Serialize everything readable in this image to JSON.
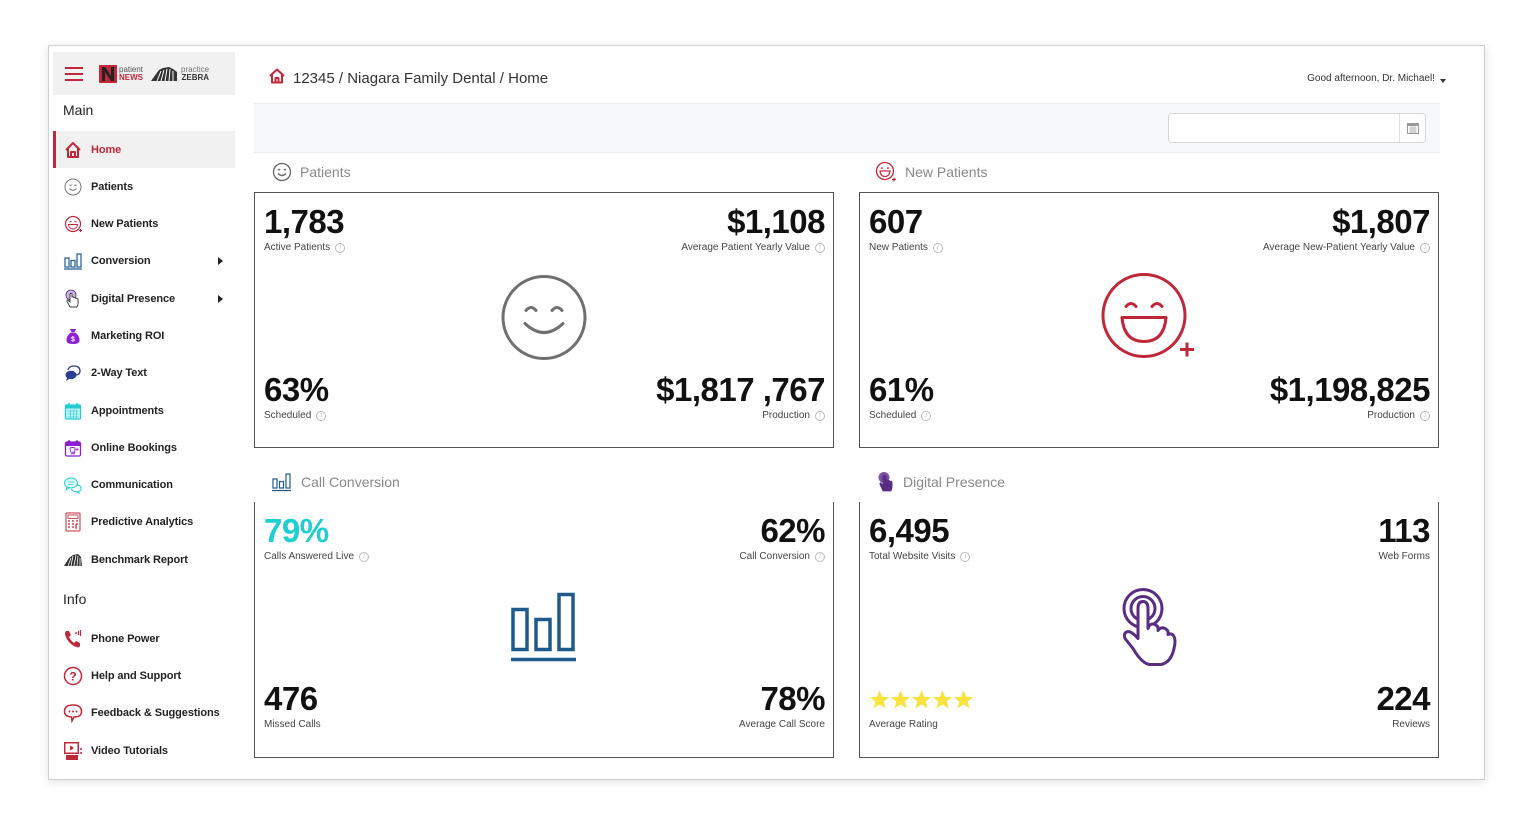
{
  "brand": {
    "patient_news_top": "patient",
    "patient_news_bottom": "NEWS",
    "practice_zebra_top": "practice",
    "practice_zebra_bottom": "ZEBRA"
  },
  "sidebar": {
    "main_heading": "Main",
    "info_heading": "Info",
    "main_items": [
      {
        "label": "Home",
        "icon": "home-icon",
        "active": true
      },
      {
        "label": "Patients",
        "icon": "smiley-icon"
      },
      {
        "label": "New Patients",
        "icon": "laughing-face-plus-icon"
      },
      {
        "label": "Conversion",
        "icon": "bar-chart-icon",
        "submenu": true
      },
      {
        "label": "Digital Presence",
        "icon": "touch-hand-icon",
        "submenu": true
      },
      {
        "label": "Marketing ROI",
        "icon": "money-bag-icon"
      },
      {
        "label": "2-Way Text",
        "icon": "chat-bubbles-icon"
      },
      {
        "label": "Appointments",
        "icon": "calendar-icon"
      },
      {
        "label": "Online Bookings",
        "icon": "calendar-tooth-icon"
      },
      {
        "label": "Communication",
        "icon": "speech-bubbles-icon"
      },
      {
        "label": "Predictive Analytics",
        "icon": "calculator-icon"
      },
      {
        "label": "Benchmark Report",
        "icon": "zebra-icon"
      }
    ],
    "info_items": [
      {
        "label": "Phone Power",
        "icon": "phone-icon"
      },
      {
        "label": "Help and Support",
        "icon": "question-circle-icon"
      },
      {
        "label": "Feedback & Suggestions",
        "icon": "comment-dots-icon"
      },
      {
        "label": "Video Tutorials",
        "icon": "video-play-icon"
      }
    ]
  },
  "header": {
    "breadcrumb": "12345 / Niagara Family Dental / Home",
    "greeting": "Good afternoon, Dr. Michael!"
  },
  "filter": {
    "date_value": "",
    "date_placeholder": ""
  },
  "colors": {
    "brand_red": "#c0283a",
    "call_blue": "#1e5a8a",
    "teal": "#1fcfd0",
    "purple": "#5a2d82",
    "star_yellow": "#f7e33b"
  },
  "cards": {
    "patients": {
      "title": "Patients",
      "top_left": {
        "value": "1,783",
        "label": "Active Patients"
      },
      "top_right": {
        "value": "$1,108",
        "label": "Average Patient Yearly Value"
      },
      "bottom_left": {
        "value": "63%",
        "label": "Scheduled"
      },
      "bottom_right": {
        "value": "$1,817 ,767",
        "label": "Production"
      }
    },
    "new_patients": {
      "title": "New Patients",
      "top_left": {
        "value": "607",
        "label": "New Patients"
      },
      "top_right": {
        "value": "$1,807",
        "label": "Average New-Patient Yearly Value"
      },
      "bottom_left": {
        "value": "61%",
        "label": "Scheduled"
      },
      "bottom_right": {
        "value": "$1,198,825",
        "label": "Production"
      }
    },
    "call_conversion": {
      "title": "Call Conversion",
      "top_left": {
        "value": "79%",
        "label": "Calls Answered Live"
      },
      "top_right": {
        "value": "62%",
        "label": "Call Conversion"
      },
      "bottom_left": {
        "value": "476",
        "label": "Missed Calls"
      },
      "bottom_right": {
        "value": "78%",
        "label": "Average Call Score"
      }
    },
    "digital_presence": {
      "title": "Digital Presence",
      "top_left": {
        "value": "6,495",
        "label": "Total Website Visits"
      },
      "top_right": {
        "value": "113",
        "label": "Web Forms"
      },
      "bottom_left": {
        "rating_stars": 5,
        "rating_max": 5,
        "label": "Average Rating"
      },
      "bottom_right": {
        "value": "224",
        "label": "Reviews"
      }
    }
  }
}
